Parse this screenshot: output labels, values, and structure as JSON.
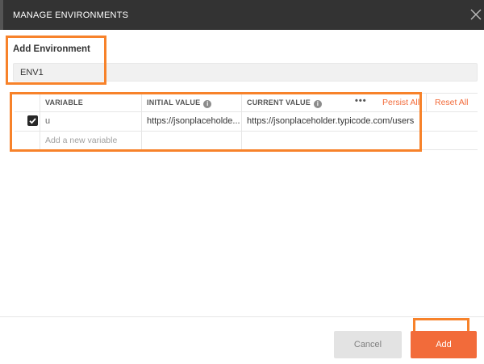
{
  "dialog": {
    "title": "MANAGE ENVIRONMENTS",
    "close_icon": "close-icon"
  },
  "environment": {
    "section_label": "Add Environment",
    "name_value": "ENV1"
  },
  "table": {
    "headers": {
      "variable": "VARIABLE",
      "initial_value": "INITIAL VALUE",
      "current_value": "CURRENT VALUE",
      "info_icon": "i"
    },
    "actions": {
      "more": "•••",
      "persist_all": "Persist All",
      "reset_all": "Reset All"
    },
    "rows": [
      {
        "checked": true,
        "variable": "u",
        "initial_value": "https://jsonplaceholde...",
        "current_value": "https://jsonplaceholder.typicode.com/users"
      }
    ],
    "new_variable_placeholder": "Add a new variable"
  },
  "footer": {
    "cancel_label": "Cancel",
    "add_label": "Add"
  },
  "colors": {
    "accent": "#f26b3a",
    "highlight": "#f7822a",
    "titlebar": "#333333"
  }
}
